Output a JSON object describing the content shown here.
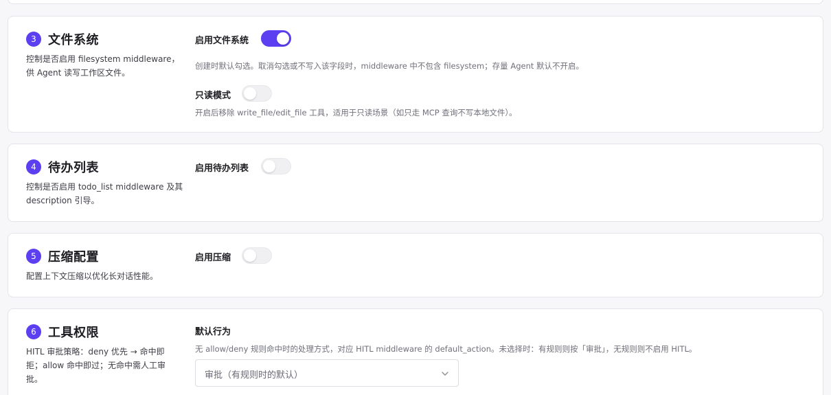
{
  "sections": [
    {
      "number": "3",
      "title": "文件系统",
      "description": "控制是否启用 filesystem middleware，供 Agent 读写工作区文件。",
      "fields": [
        {
          "label": "启用文件系统",
          "enabled": true,
          "help": "创建时默认勾选。取消勾选或不写入该字段时，middleware 中不包含 filesystem；存量 Agent 默认不开启。"
        },
        {
          "label": "只读模式",
          "enabled": false,
          "help": "开启后移除 write_file/edit_file 工具，适用于只读场景（如只走 MCP 查询不写本地文件）。"
        }
      ]
    },
    {
      "number": "4",
      "title": "待办列表",
      "description": "控制是否启用 todo_list middleware 及其 description 引导。",
      "fields": [
        {
          "label": "启用待办列表",
          "enabled": false
        }
      ]
    },
    {
      "number": "5",
      "title": "压缩配置",
      "description": "配置上下文压缩以优化长对话性能。",
      "fields": [
        {
          "label": "启用压缩",
          "enabled": false
        }
      ]
    },
    {
      "number": "6",
      "title": "工具权限",
      "description": "HITL 审批策略：deny 优先 → 命中即拒；allow 命中即过；无命中需人工审批。",
      "fields": [
        {
          "label": "默认行为",
          "help": "无 allow/deny 规则命中时的处理方式，对应 HITL middleware 的 default_action。未选择时：有规则则按「审批」，无规则则不启用 HITL。",
          "select_value": "审批（有规则时的默认）"
        }
      ]
    }
  ],
  "colors": {
    "accent": "#5b3ff0",
    "toggle_off": "#f0f0f3"
  },
  "icons": {
    "select_chevron": "chevron-down-icon"
  }
}
